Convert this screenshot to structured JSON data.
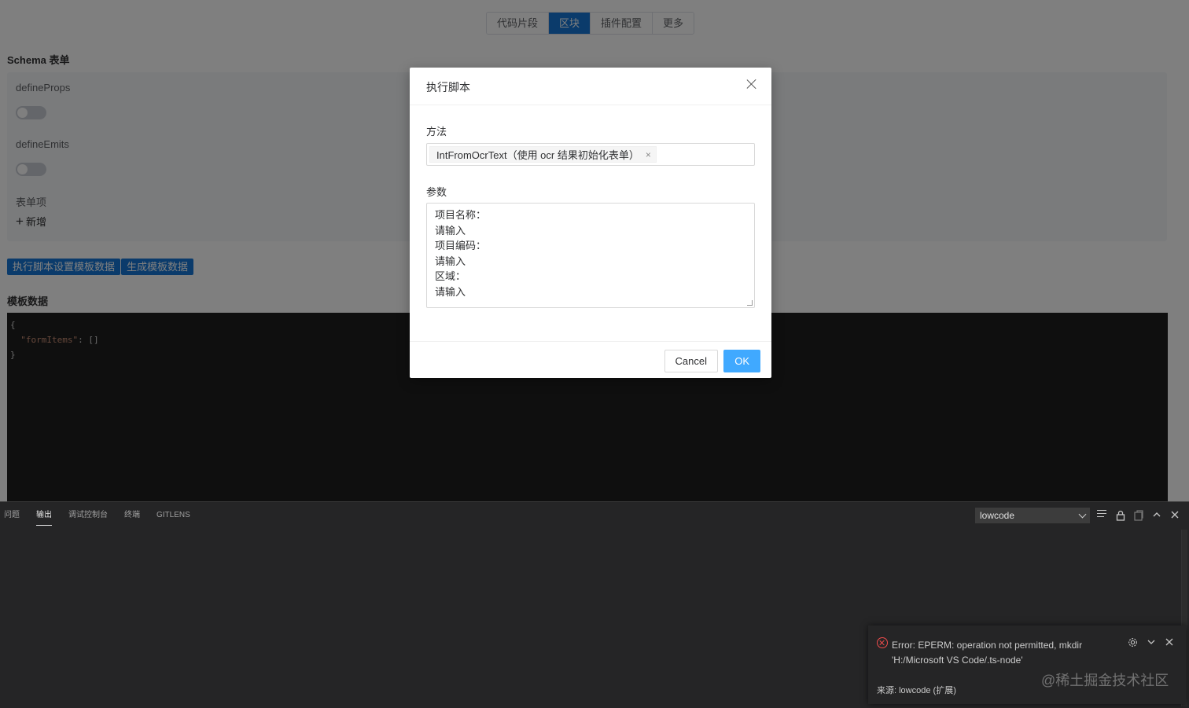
{
  "webview": {
    "tabs": [
      "代码片段",
      "区块",
      "插件配置",
      "更多"
    ],
    "active_tab": "区块",
    "schema_title": "Schema 表单",
    "define_props_label": "defineProps",
    "define_emits_label": "defineEmits",
    "form_items_label": "表单项",
    "add_label": "新增",
    "exec_script_button": "执行脚本设置模板数据",
    "gen_template_button": "生成模板数据",
    "template_data_title": "模板数据",
    "code": {
      "line1": "{",
      "line2_key": "\"formItems\"",
      "line2_rest": ": []",
      "line3": "}"
    }
  },
  "modal": {
    "title": "执行脚本",
    "method_label": "方法",
    "method_value": "IntFromOcrText（使用 ocr 结果初始化表单）",
    "params_label": "参数",
    "params_lines": [
      "项目名称：",
      "请输入",
      "项目编码：",
      "请输入",
      "区域：",
      "请输入"
    ],
    "cancel_label": "Cancel",
    "ok_label": "OK"
  },
  "panel": {
    "tabs": [
      "问题",
      "输出",
      "调试控制台",
      "终端",
      "GITLENS"
    ],
    "active_tab": "输出",
    "output_channel": "lowcode"
  },
  "notification": {
    "message_line1": "Error: EPERM: operation not permitted, mkdir",
    "message_line2": "'H:/Microsoft VS Code/.ts-node'",
    "source": "来源: lowcode (扩展)"
  },
  "watermark": "@稀土掘金技术社区",
  "colors": {
    "primary": "#1677d6",
    "ok_button": "#40a9ff",
    "error": "#f14c4c",
    "panel_bg": "#252526"
  }
}
